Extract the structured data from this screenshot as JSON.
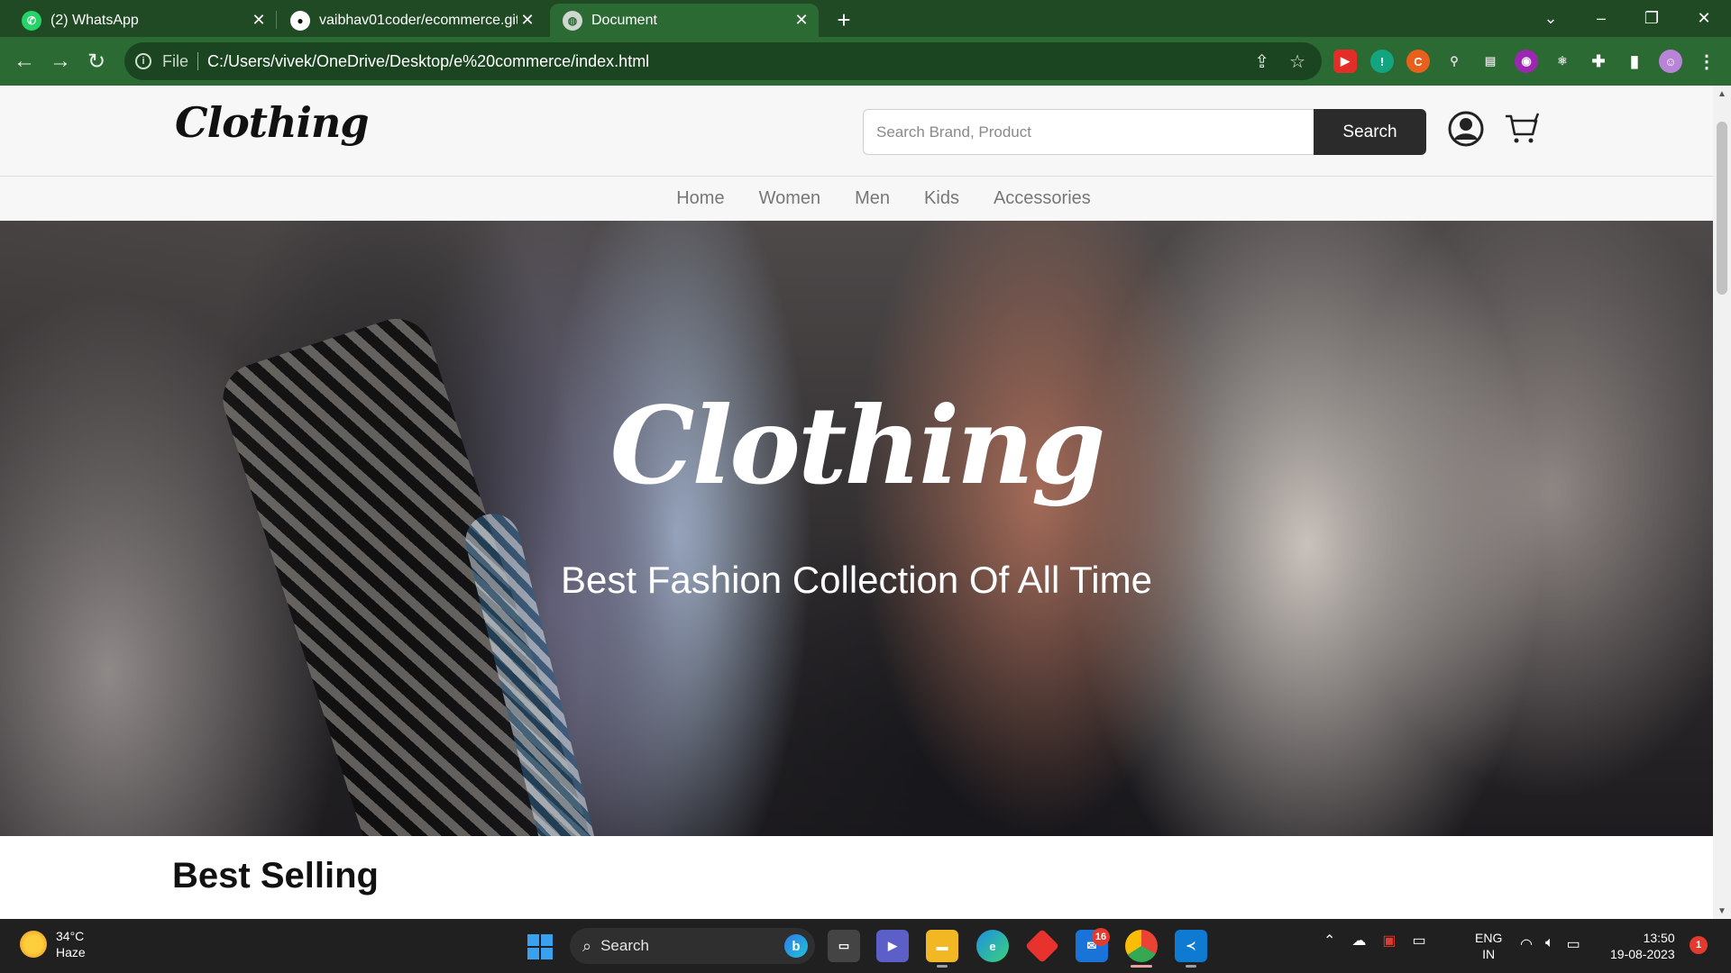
{
  "browser": {
    "tabs": [
      {
        "title": "(2) WhatsApp",
        "active": false
      },
      {
        "title": "vaibhav01coder/ecommerce.gith",
        "active": false
      },
      {
        "title": "Document",
        "active": true
      }
    ],
    "address": {
      "scheme_label": "File",
      "url": "C:/Users/vivek/OneDrive/Desktop/e%20commerce/index.html"
    }
  },
  "site": {
    "logo": "Clothing",
    "search": {
      "placeholder": "Search Brand, Product",
      "button_label": "Search"
    },
    "nav": [
      "Home",
      "Women",
      "Men",
      "Kids",
      "Accessories"
    ],
    "hero": {
      "logo": "Clothing",
      "tagline": "Best Fashion Collection Of All Time"
    },
    "section_title": "Best Selling"
  },
  "taskbar": {
    "weather": {
      "temp": "34°C",
      "condition": "Haze"
    },
    "search_label": "Search",
    "mail_badge": "16",
    "language": {
      "line1": "ENG",
      "line2": "IN"
    },
    "clock": {
      "time": "13:50",
      "date": "19-08-2023"
    },
    "notifications": "1"
  },
  "colors": {
    "tab_strip": "#1f4a24",
    "toolbar": "#2c6a34",
    "search_button": "#2b2b2b",
    "taskbar": "#202020"
  }
}
